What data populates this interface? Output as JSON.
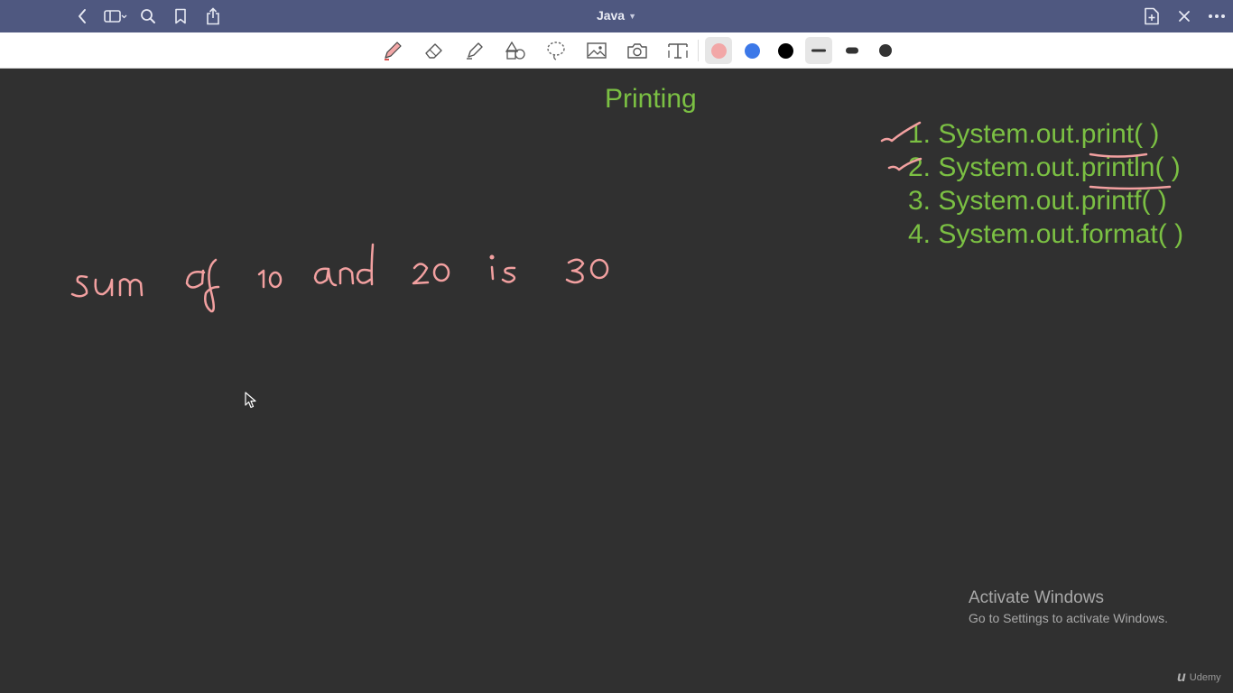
{
  "titlebar": {
    "title": "Java",
    "left_icons": [
      "back-icon",
      "sidebar-icon",
      "search-icon",
      "bookmark-icon",
      "share-icon"
    ],
    "right_icons": [
      "new-page-icon",
      "close-icon",
      "more-icon"
    ]
  },
  "toolbar": {
    "tools": [
      "pen-icon",
      "eraser-icon",
      "highlighter-icon",
      "shapes-icon",
      "lasso-icon",
      "image-icon",
      "camera-icon",
      "text-icon"
    ],
    "colors": [
      "#f2a7a7",
      "#3c78e8",
      "#000000"
    ],
    "selected_color": "#f2a7a7",
    "stroke_widths": [
      "thin",
      "medium",
      "thick"
    ],
    "selected_width": "thin"
  },
  "note": {
    "heading": "Printing",
    "methods": [
      "1. System.out.print( )",
      "2. System.out.println( )",
      "3. System.out.printf( )",
      "4. System.out.format( )"
    ],
    "handwriting": "sum of 10 and 20 is 30",
    "heading_color": "#7bc043",
    "ink_color": "#f2a0a0"
  },
  "watermark": {
    "line1": "Activate Windows",
    "line2": "Go to Settings to activate Windows."
  },
  "brand": {
    "logo": "u",
    "name": "Udemy"
  }
}
